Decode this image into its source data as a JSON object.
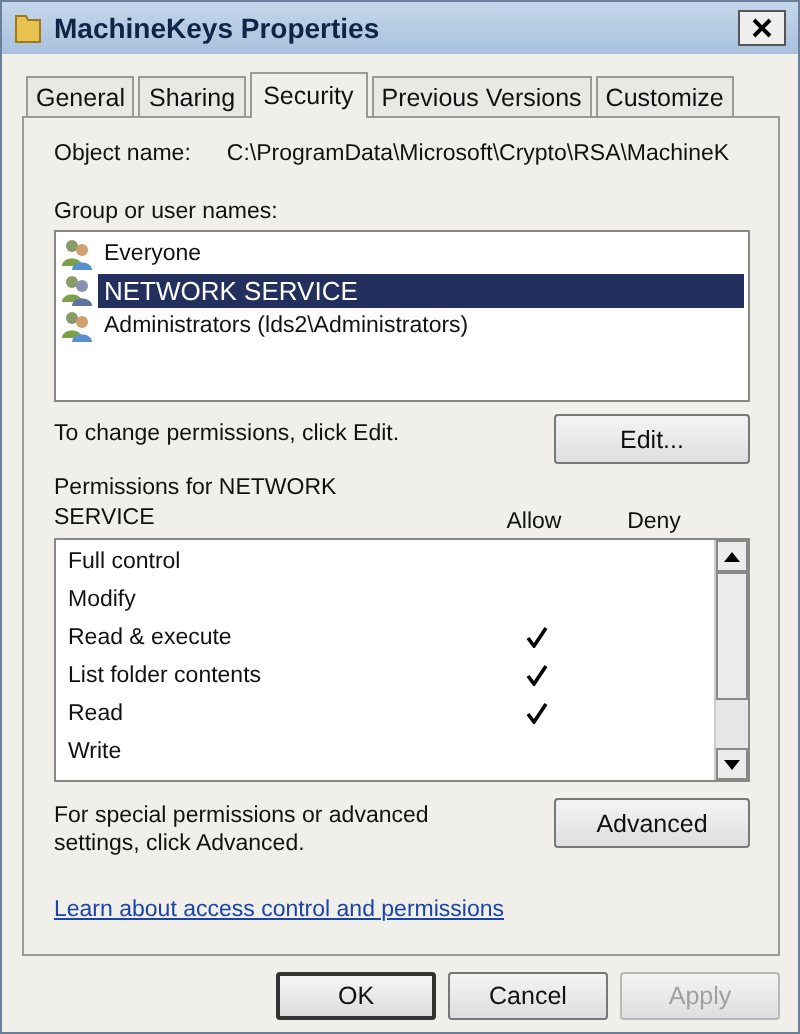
{
  "window": {
    "title": "MachineKeys Properties"
  },
  "tabs": [
    {
      "label": "General",
      "selected": false
    },
    {
      "label": "Sharing",
      "selected": false
    },
    {
      "label": "Security",
      "selected": true
    },
    {
      "label": "Previous Versions",
      "selected": false
    },
    {
      "label": "Customize",
      "selected": false
    }
  ],
  "object_name": {
    "label": "Object name:",
    "value": "C:\\ProgramData\\Microsoft\\Crypto\\RSA\\MachineK"
  },
  "groups": {
    "label": "Group or user names:",
    "items": [
      {
        "name": "Everyone",
        "selected": false
      },
      {
        "name": "NETWORK SERVICE",
        "selected": true
      },
      {
        "name": "Administrators (lds2\\Administrators)",
        "selected": false
      }
    ]
  },
  "edit_hint": "To change permissions, click Edit.",
  "edit_button": "Edit...",
  "permissions": {
    "label": "Permissions for NETWORK SERVICE",
    "allow_header": "Allow",
    "deny_header": "Deny",
    "rows": [
      {
        "name": "Full control",
        "allow": false
      },
      {
        "name": "Modify",
        "allow": false
      },
      {
        "name": "Read & execute",
        "allow": true
      },
      {
        "name": "List folder contents",
        "allow": true
      },
      {
        "name": "Read",
        "allow": true
      },
      {
        "name": "Write",
        "allow": false
      }
    ]
  },
  "advanced_hint": "For special permissions or advanced settings, click Advanced.",
  "advanced_button": "Advanced",
  "link": "Learn about access control and permissions",
  "buttons": [
    {
      "label": "OK",
      "disabled": false,
      "default": true
    },
    {
      "label": "Cancel",
      "disabled": false,
      "default": false
    },
    {
      "label": "Apply",
      "disabled": true,
      "default": false
    }
  ]
}
